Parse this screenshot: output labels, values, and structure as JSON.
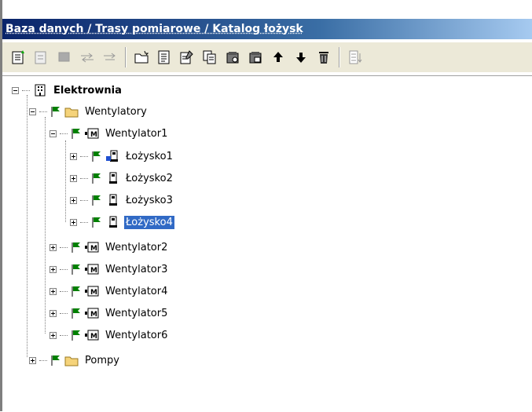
{
  "window": {
    "breadcrumb": "Baza danych / Trasy pomiarowe / Katalog łożysk"
  },
  "toolbar": {
    "buttons": [
      {
        "icon": "new-item-icon",
        "enabled": true
      },
      {
        "icon": "edit-item-icon",
        "enabled": false
      },
      {
        "icon": "stop-icon",
        "enabled": false
      },
      {
        "icon": "arrow-left-right-icon",
        "enabled": false
      },
      {
        "icon": "arrow-right-icon",
        "enabled": false
      },
      {
        "icon": "new-folder-icon",
        "enabled": true
      },
      {
        "icon": "properties-icon",
        "enabled": true
      },
      {
        "icon": "edit-properties-icon",
        "enabled": true
      },
      {
        "icon": "copy-icon",
        "enabled": true
      },
      {
        "icon": "database-icon",
        "enabled": true
      },
      {
        "icon": "database-copy-icon",
        "enabled": true
      },
      {
        "icon": "move-up-icon",
        "enabled": true
      },
      {
        "icon": "move-down-icon",
        "enabled": true
      },
      {
        "icon": "delete-icon",
        "enabled": true
      },
      {
        "icon": "sort-icon",
        "enabled": false
      }
    ]
  },
  "tree": {
    "root": "Elektrownia",
    "group1": "Wentylatory",
    "fan1": "Wentylator1",
    "bearings": [
      "Łożysko1",
      "Łożysko2",
      "Łożysko3",
      "Łożysko4"
    ],
    "fans": [
      "Wentylator2",
      "Wentylator3",
      "Wentylator4",
      "Wentylator5",
      "Wentylator6"
    ],
    "group2": "Pompy"
  },
  "colors": {
    "selection": "#316ac5",
    "flag": "#008000",
    "titlebar": "#0a246a"
  }
}
